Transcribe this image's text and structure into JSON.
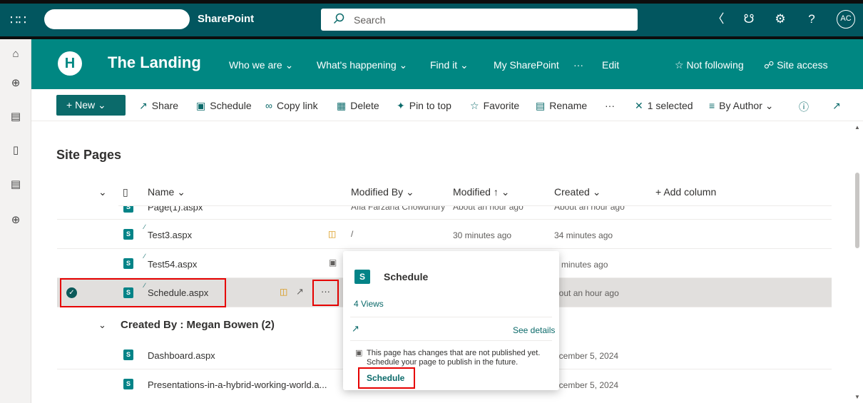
{
  "suite": {
    "app_name": "SharePoint",
    "search_placeholder": "Search",
    "avatar": "AC"
  },
  "site": {
    "logo_letter": "H",
    "title": "The Landing",
    "nav": [
      "Who we are",
      "What's happening",
      "Find it",
      "My SharePoint",
      "···",
      "Edit"
    ],
    "follow": "Not following",
    "access": "Site access"
  },
  "command": {
    "new": "New",
    "share": "Share",
    "schedule": "Schedule",
    "copy_link": "Copy link",
    "delete": "Delete",
    "pin": "Pin to top",
    "favorite": "Favorite",
    "rename": "Rename",
    "more": "···",
    "selected": "1 selected",
    "view": "By Author"
  },
  "library": {
    "title": "Site Pages",
    "columns": {
      "name": "Name",
      "modified_by": "Modified By",
      "modified": "Modified",
      "created": "Created",
      "add": "Add column"
    },
    "rows": [
      {
        "name": "Page(1).aspx",
        "modified_by": "Afia Farzana Chowdhury",
        "modified": "About an hour ago",
        "created": "About an hour ago"
      },
      {
        "name": "Test3.aspx",
        "modified_by": "/",
        "modified": "30 minutes ago",
        "created": "34 minutes ago"
      },
      {
        "name": "Test54.aspx",
        "created": "0 minutes ago"
      },
      {
        "name": "Schedule.aspx",
        "more": "···",
        "created": "About an hour ago",
        "created_visible": "bout an hour ago"
      }
    ],
    "group": "Created By : Megan Bowen (2)",
    "group_rows": [
      {
        "name": "Dashboard.aspx",
        "created": "ecember 5, 2024"
      },
      {
        "name": "Presentations-in-a-hybrid-working-world.a...",
        "created": "ecember 5, 2024"
      }
    ]
  },
  "popup": {
    "title": "Schedule",
    "views": "4 Views",
    "see_details": "See details",
    "message": "This page has changes that are not published yet. Schedule your page to publish in the future.",
    "action": "Schedule"
  }
}
